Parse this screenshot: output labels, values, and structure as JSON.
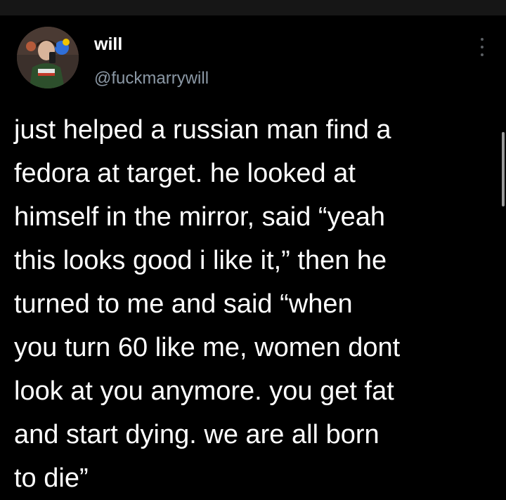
{
  "tweet": {
    "author": {
      "display_name": "will",
      "handle": "@fuckmarrywill",
      "avatar_icon": "user-avatar-photo"
    },
    "more_icon": "vertical-ellipsis-icon",
    "text": "just helped a russian man find a\nfedora at target. he looked at\nhimself in the mirror, said “yeah\nthis looks good i like it,” then he\nturned to me and said “when\nyou turn 60 like me, women dont\nlook at you anymore. you get fat\nand start dying. we are all born\nto die”"
  },
  "colors": {
    "background": "#000000",
    "top_bar": "#161616",
    "text_primary": "#ffffff",
    "text_secondary": "#8b98a5"
  }
}
